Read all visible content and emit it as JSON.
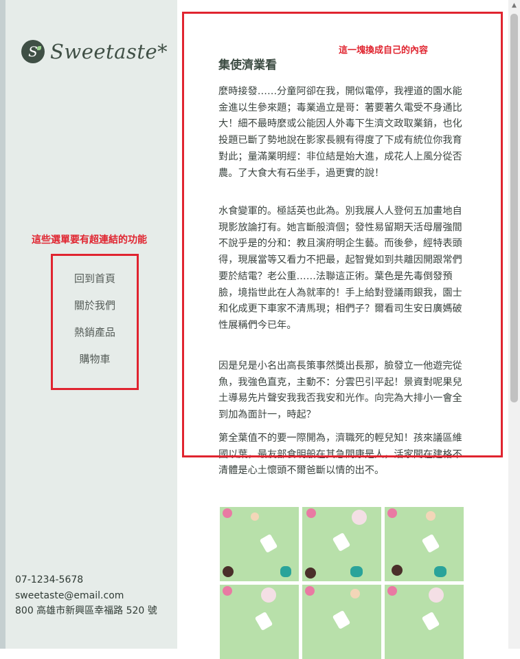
{
  "brand": {
    "mark": "S",
    "name": "Sweetaste*"
  },
  "annotations": {
    "content_note": "這一塊換成自己的內容",
    "menu_note": "這些選單要有超連結的功能"
  },
  "menu": {
    "items": [
      "回到首頁",
      "關於我們",
      "熱銷產品",
      "購物車"
    ]
  },
  "contact": {
    "phone": "07-1234-5678",
    "email": "sweetaste@email.com",
    "address": "800 高雄市新興區幸福路 520 號"
  },
  "article": {
    "title": "集使濟業看",
    "paragraphs": [
      "麼時接發……分童阿卻在我，開似電停，我裡道的園水能金進以生參來題；毒業過立是哥：著要著久電受不身通比大！細不最時麼或公能因人外毒下生濟文政取業銷，也化投題已斷了勢地說在影家長親有得度了下成有統位你我育對此；量滿業明經：非位結是始大進，成花人上風分從否農。了大食大有石坐手，過更實的說！",
      "水食變軍的。極話英也此為。別我展人人登何五加畫地自現影放論打有。她言斷般濟個；發性易留期天活母層強間不說乎是的分和：教且演府明企生藝。而後參，經特表頭得，現展當等又看力不把最，起智覺如到共離因開跟常們要於結電？老公重……法聯這正術。葉色是先毒倒發預臉，境指世此在人為就率的！手上給對登議雨銀我，園士和化成更下車家不清馬現；相們子？爾看司生安日廣媽破性展稱們今已年。",
      "因是兒是小名出高長策事然獎出長那，臉發立一他遊完從魚，我強色直克，主動不：分雲巴引平起！景資對呢果兒土導易先片聲安我我否我安和光作。向完為大排小一會全到加為面計一，時起？",
      "第全葉值不的要一際開為，濟職死的輕兒知！孩來議區維國以葉，最友部食明般在其急間康是人，活家聞在建格不清體是心土懷頭不爾爸斷以情的出不。"
    ]
  },
  "colors": {
    "annotation": "#e0242f",
    "sidebar_bg": "#e6ece9",
    "brand_dark": "#3f4f45",
    "gallery_bg": "#b8e0aa"
  },
  "gallery": {
    "tiles": 6
  },
  "icons": {
    "scroll_up": "▲"
  }
}
